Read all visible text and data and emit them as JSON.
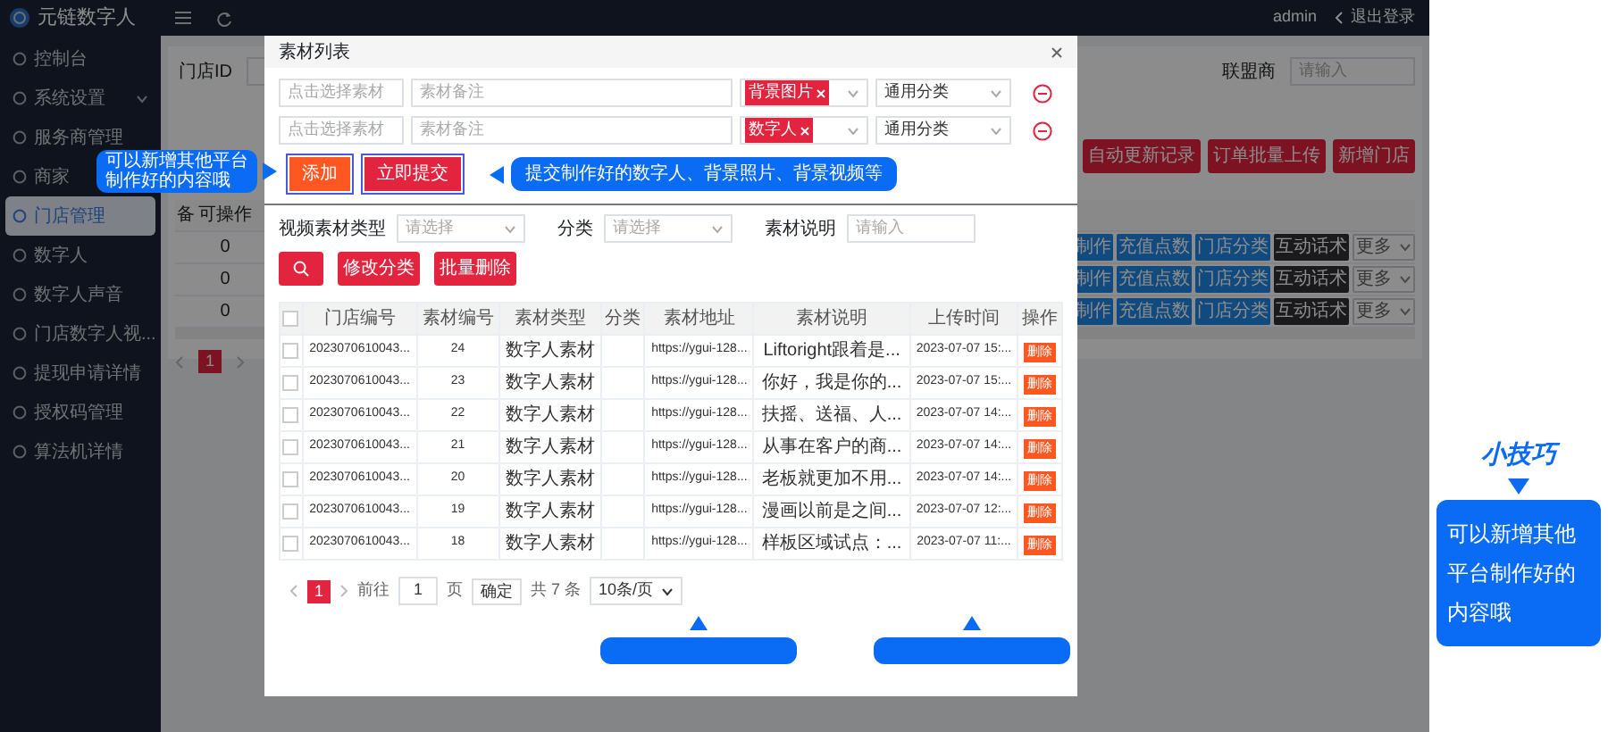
{
  "app_header": {
    "logo_text": "元链数字人",
    "user": "admin",
    "logout": "退出登录"
  },
  "sidebar": {
    "items": [
      {
        "label": "控制台",
        "kind": "link",
        "selected": false
      },
      {
        "label": "系统设置",
        "kind": "group",
        "selected": false
      },
      {
        "label": "服务商管理",
        "kind": "link",
        "selected": false
      },
      {
        "label": "商家",
        "kind": "link",
        "selected": false
      },
      {
        "label": "门店管理",
        "kind": "link",
        "selected": true
      },
      {
        "label": "数字人",
        "kind": "link",
        "selected": false
      },
      {
        "label": "数字人声音",
        "kind": "link",
        "selected": false
      },
      {
        "label": "门店数字人视...",
        "kind": "link",
        "selected": false
      },
      {
        "label": "提现申请详情",
        "kind": "link",
        "selected": false
      },
      {
        "label": "授权码管理",
        "kind": "link",
        "selected": false
      },
      {
        "label": "算法机详情",
        "kind": "link",
        "selected": false
      }
    ]
  },
  "store_page": {
    "filters": [
      {
        "label": "门店ID"
      },
      {
        "label": "联盟商",
        "placeholder": "请输入"
      }
    ],
    "buttons": [
      "自动更新记录",
      "订单批量上传",
      "新增门店"
    ],
    "table": {
      "columns": [
        "备",
        "可操作"
      ],
      "rows": [
        {
          "cells": [
            "0"
          ],
          "actions": [
            {
              "label": "制作",
              "kind": "info"
            },
            {
              "label": "充值点数",
              "kind": "info"
            },
            {
              "label": "门店分类",
              "kind": "info"
            },
            {
              "label": "互动话术",
              "kind": "dark"
            },
            {
              "label": "更多",
              "kind": "dropdown"
            }
          ]
        },
        {
          "cells": [
            "0"
          ],
          "actions": [
            {
              "label": "制作",
              "kind": "info"
            },
            {
              "label": "充值点数",
              "kind": "info"
            },
            {
              "label": "门店分类",
              "kind": "info"
            },
            {
              "label": "互动话术",
              "kind": "dark"
            },
            {
              "label": "更多",
              "kind": "dropdown"
            }
          ]
        },
        {
          "cells": [
            "0"
          ],
          "actions": [
            {
              "label": "制作",
              "kind": "info"
            },
            {
              "label": "充值点数",
              "kind": "info"
            },
            {
              "label": "门店分类",
              "kind": "info"
            },
            {
              "label": "互动话术",
              "kind": "dark"
            },
            {
              "label": "更多",
              "kind": "dropdown"
            }
          ]
        }
      ]
    },
    "pagination": {
      "pages": [
        {
          "label": "1",
          "selected": true
        }
      ]
    }
  },
  "dialog": {
    "title": "素材列表",
    "material_rows": [
      {
        "material_placeholder": "点击选择素材",
        "note_placeholder": "素材备注",
        "tag": "背景图片",
        "category": "通用分类"
      },
      {
        "material_placeholder": "点击选择素材",
        "note_placeholder": "素材备注",
        "tag": "数字人",
        "category": "通用分类"
      }
    ],
    "actions": [
      {
        "label": "添加",
        "kind": "add"
      },
      {
        "label": "立即提交",
        "kind": "submit"
      }
    ],
    "filters": [
      {
        "label": "视频素材类型",
        "kind": "select",
        "placeholder": "请选择"
      },
      {
        "label": "分类",
        "kind": "select",
        "placeholder": "请选择"
      },
      {
        "label": "素材说明",
        "kind": "input",
        "placeholder": "请输入"
      }
    ],
    "toolbar": [
      "修改分类",
      "批量删除"
    ],
    "table": {
      "all_checked": false,
      "columns": [
        "门店编号",
        "素材编号",
        "素材类型",
        "分类",
        "素材地址",
        "素材说明",
        "上传时间",
        "操作"
      ],
      "rows": [
        {
          "checked": false,
          "store_no": "2023070610043...",
          "material_no": "24",
          "type": "数字人素材",
          "address": "https://ygui-128...",
          "description": "Liftoright跟着是...",
          "upload_time": "2023-07-07 15:...",
          "action": "删除"
        },
        {
          "checked": false,
          "store_no": "2023070610043...",
          "material_no": "23",
          "type": "数字人素材",
          "address": "https://ygui-128...",
          "description": "你好，我是你的...",
          "upload_time": "2023-07-07 15:...",
          "action": "删除"
        },
        {
          "checked": false,
          "store_no": "2023070610043...",
          "material_no": "22",
          "type": "数字人素材",
          "address": "https://ygui-128...",
          "description": "扶摇、送福、人...",
          "upload_time": "2023-07-07 14:...",
          "action": "删除"
        },
        {
          "checked": false,
          "store_no": "2023070610043...",
          "material_no": "21",
          "type": "数字人素材",
          "address": "https://ygui-128...",
          "description": "从事在客户的商...",
          "upload_time": "2023-07-07 14:...",
          "action": "删除"
        },
        {
          "checked": false,
          "store_no": "2023070610043...",
          "material_no": "20",
          "type": "数字人素材",
          "address": "https://ygui-128...",
          "description": "老板就更加不用...",
          "upload_time": "2023-07-07 14:...",
          "action": "删除"
        },
        {
          "checked": false,
          "store_no": "2023070610043...",
          "material_no": "19",
          "type": "数字人素材",
          "address": "https://ygui-128...",
          "description": "漫画以前是之间...",
          "upload_time": "2023-07-07 12:...",
          "action": "删除"
        },
        {
          "checked": false,
          "store_no": "2023070610043...",
          "material_no": "18",
          "type": "数字人素材",
          "address": "https://ygui-128...",
          "description": "样板区域试点：...",
          "upload_time": "2023-07-07 11:...",
          "action": "删除"
        }
      ]
    },
    "pagination": {
      "pages": [
        {
          "label": "1",
          "selected": true
        }
      ],
      "goto_label": "前往",
      "goto_value": "1",
      "page_unit": "页",
      "confirm": "确定",
      "total": "共 7 条",
      "page_size": "10条/页"
    }
  },
  "callouts": [
    {
      "text": "可以新增其他平台制作好的内容哦",
      "kind": "right"
    },
    {
      "text": "提交制作好的数字人、背景照片、背景视频等",
      "kind": "left"
    },
    {
      "kind": "up"
    },
    {
      "kind": "up"
    }
  ],
  "tip": {
    "title": "小技巧",
    "text": "可以新增其他平台制作好的内容哦"
  }
}
